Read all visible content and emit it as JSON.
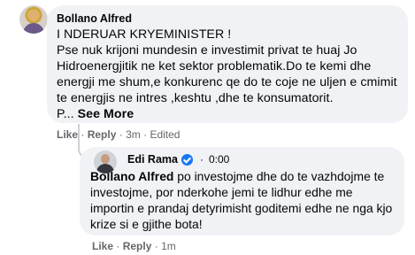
{
  "comment": {
    "author": "Bollano Alfred",
    "text_line1": "I NDERUAR KRYEMINISTER !",
    "text_body": "Pse nuk krijoni mundesin e investimit privat te huaj Jo Hidroenergjitik ne ket sektor problematik.Do te kemi dhe energji me shum,e konkurenc qe do te coje ne uljen e cmimit te energjis ne intres ,keshtu ,dhe te konsumatorit.",
    "truncated": "P...",
    "see_more": "See More",
    "actions": {
      "like": "Like",
      "reply": "Reply",
      "time": "3m",
      "edited": "Edited"
    }
  },
  "reply": {
    "author": "Edi Rama",
    "audio_time": "0:00",
    "mention": "Bollano Alfred",
    "text": " po investojme dhe do te vazhdojme te investojme, por nderkohe jemi te lidhur edhe me importin e prandaj detyrimisht goditemi edhe ne nga kjo krize si e gjithe bota!",
    "actions": {
      "like": "Like",
      "reply": "Reply",
      "time": "1m"
    }
  },
  "separator": "·",
  "icons": {
    "verified": "verified-badge-icon"
  }
}
